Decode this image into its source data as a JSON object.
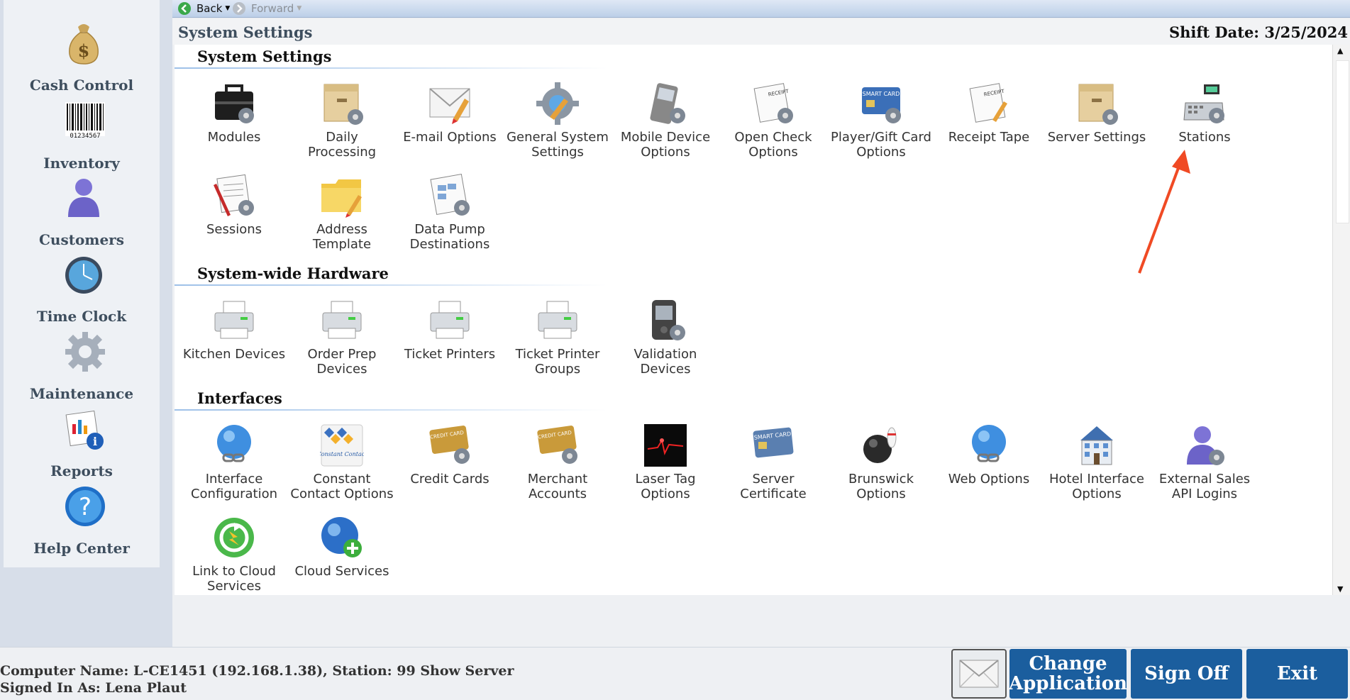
{
  "nav": {
    "back": "Back",
    "forward": "Forward"
  },
  "header": {
    "title": "System Settings",
    "shift_date": "Shift Date: 3/25/2024"
  },
  "sidebar": [
    {
      "label": "Cash Control",
      "icon": "money-bag-icon"
    },
    {
      "label": "Inventory",
      "icon": "barcode-icon"
    },
    {
      "label": "Customers",
      "icon": "person-icon"
    },
    {
      "label": "Time Clock",
      "icon": "clock-icon"
    },
    {
      "label": "Maintenance",
      "icon": "gear-icon"
    },
    {
      "label": "Reports",
      "icon": "reports-icon"
    },
    {
      "label": "Help Center",
      "icon": "help-icon"
    }
  ],
  "sections": [
    {
      "title": "System Settings",
      "items": [
        {
          "label1": "Modules",
          "label2": ""
        },
        {
          "label1": "Daily",
          "label2": "Processing"
        },
        {
          "label1": "E-mail Options",
          "label2": ""
        },
        {
          "label1": "General System",
          "label2": "Settings"
        },
        {
          "label1": "Mobile Device",
          "label2": "Options"
        },
        {
          "label1": "Open Check",
          "label2": "Options"
        },
        {
          "label1": "Player/Gift Card",
          "label2": "Options"
        },
        {
          "label1": "Receipt Tape",
          "label2": ""
        },
        {
          "label1": "Server Settings",
          "label2": ""
        },
        {
          "label1": "Stations",
          "label2": ""
        },
        {
          "label1": "Sessions",
          "label2": ""
        },
        {
          "label1": "Address",
          "label2": "Template"
        },
        {
          "label1": "Data Pump",
          "label2": "Destinations"
        }
      ]
    },
    {
      "title": "System-wide Hardware",
      "items": [
        {
          "label1": "Kitchen Devices",
          "label2": ""
        },
        {
          "label1": "Order Prep",
          "label2": "Devices"
        },
        {
          "label1": "Ticket Printers",
          "label2": ""
        },
        {
          "label1": "Ticket Printer",
          "label2": "Groups"
        },
        {
          "label1": "Validation",
          "label2": "Devices"
        }
      ]
    },
    {
      "title": "Interfaces",
      "items": [
        {
          "label1": "Interface",
          "label2": "Configuration"
        },
        {
          "label1": "Constant",
          "label2": "Contact Options"
        },
        {
          "label1": "Credit Cards",
          "label2": ""
        },
        {
          "label1": "Merchant",
          "label2": "Accounts"
        },
        {
          "label1": "Laser Tag",
          "label2": "Options"
        },
        {
          "label1": "Server",
          "label2": "Certificate"
        },
        {
          "label1": "Brunswick",
          "label2": "Options"
        },
        {
          "label1": "Web Options",
          "label2": ""
        },
        {
          "label1": "Hotel Interface",
          "label2": "Options"
        },
        {
          "label1": "External Sales",
          "label2": "API Logins"
        },
        {
          "label1": "Link to Cloud",
          "label2": "Services"
        },
        {
          "label1": "Cloud Services",
          "label2": ""
        }
      ]
    }
  ],
  "icon_text": {
    "receipt": "RECEIPT",
    "smart_card": "SMART CARD",
    "constant_contact": "Constant Contact",
    "credit_card": "CREDIT CARD",
    "barcode_digits": "01234567",
    "dollar": "$",
    "help": "?",
    "info": "i"
  },
  "status": {
    "computer": "Computer Name: L-CE1451 (192.168.1.38), Station: 99 Show Server",
    "signed_in": "Signed In As: Lena Plaut"
  },
  "buttons": {
    "change_line1": "Change",
    "change_line2": "Application",
    "sign_off": "Sign Off",
    "exit": "Exit"
  },
  "colors": {
    "primary_button": "#1b5e9e",
    "annotation_arrow": "#f04a24",
    "section_line": "#9dc0e8"
  }
}
